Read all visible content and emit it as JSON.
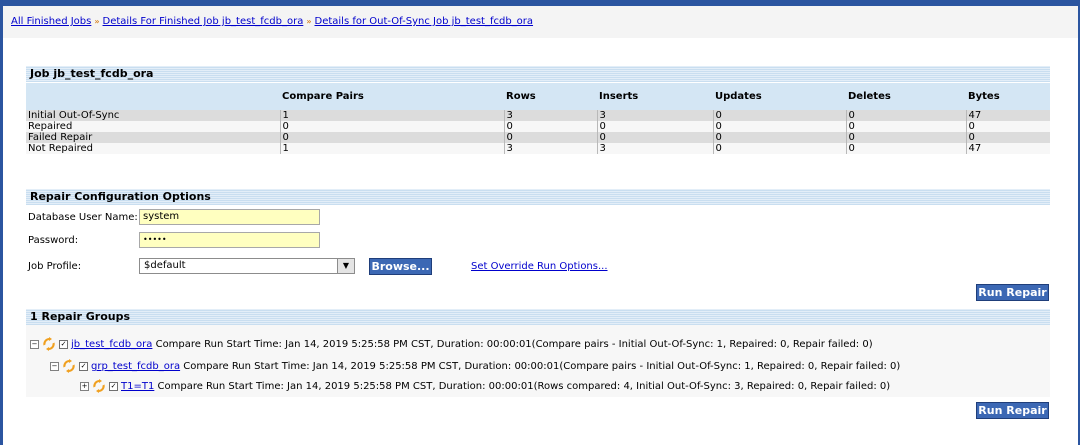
{
  "breadcrumbs": [
    {
      "label": "All Finished Jobs"
    },
    {
      "label": "Details For Finished Job jb_test_fcdb_ora"
    },
    {
      "label": "Details for Out-Of-Sync Job jb_test_fcdb_ora"
    }
  ],
  "breadcrumb_separator": "»",
  "job_table": {
    "title": "Job jb_test_fcdb_ora",
    "columns": [
      "",
      "Compare Pairs",
      "Rows",
      "Inserts",
      "Updates",
      "Deletes",
      "Bytes"
    ],
    "rows": [
      [
        "Initial Out-Of-Sync",
        "1",
        "3",
        "3",
        "0",
        "0",
        "47"
      ],
      [
        "Repaired",
        "0",
        "0",
        "0",
        "0",
        "0",
        "0"
      ],
      [
        "Failed Repair",
        "0",
        "0",
        "0",
        "0",
        "0",
        "0"
      ],
      [
        "Not Repaired",
        "1",
        "3",
        "3",
        "0",
        "0",
        "47"
      ]
    ]
  },
  "repair_config": {
    "title": "Repair Configuration Options",
    "db_user_label": "Database User Name:",
    "db_user_value": "system",
    "password_label": "Password:",
    "password_value": "•••••",
    "job_profile_label": "Job Profile:",
    "job_profile_value": "$default",
    "browse_label": "Browse...",
    "override_link": "Set Override Run Options..."
  },
  "run_repair_label": "Run Repair",
  "repair_groups": {
    "title": "1 Repair Groups",
    "items": [
      {
        "name": "jb_test_fcdb_ora",
        "text": " Compare Run Start Time: Jan 14, 2019 5:25:58 PM CST, Duration: 00:00:01(Compare pairs - Initial Out-Of-Sync: 1, Repaired: 0, Repair failed: 0)",
        "expander": "−"
      },
      {
        "name": "grp_test_fcdb_ora",
        "text": " Compare Run Start Time: Jan 14, 2019 5:25:58 PM CST, Duration: 00:00:01(Compare pairs - Initial Out-Of-Sync: 1, Repaired: 0, Repair failed: 0)",
        "expander": "−"
      },
      {
        "name": "T1=T1",
        "text": " Compare Run Start Time: Jan 14, 2019 5:25:58 PM CST, Duration: 00:00:01(Rows compared: 4, Initial Out-Of-Sync: 3, Repaired: 0, Repair failed: 0)",
        "expander": "+"
      }
    ]
  },
  "colors": {
    "accent": "#2b55a0",
    "header_stripe": "#c9def0",
    "sync_icon": "#f0a020",
    "link": "#0000cc"
  },
  "icons": {
    "sync": "sync-icon",
    "checkbox": "checkbox-icon",
    "expander": "tree-expander-icon",
    "dropdown": "chevron-down-icon"
  }
}
